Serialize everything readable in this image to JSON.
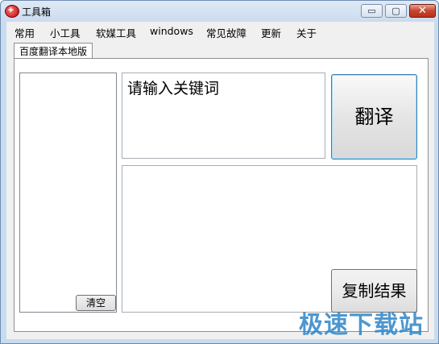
{
  "window": {
    "title": "工具箱",
    "controls": {
      "minimize": "▭",
      "maximize": "▢",
      "close": "✕"
    }
  },
  "menu": {
    "items": [
      "常用",
      "小工具",
      "软媒工具",
      "windows",
      "常见故障",
      "更新",
      "关于"
    ]
  },
  "tab": {
    "label": "百度翻译本地版"
  },
  "left_panel": {
    "clear_label": "清空"
  },
  "input": {
    "placeholder": "请输入关键词"
  },
  "buttons": {
    "translate_label": "翻译",
    "copy_label": "复制结果"
  },
  "watermark": {
    "text": "极速下载站"
  },
  "colors": {
    "accent": "#3c7fb1",
    "watermark": "#2d86c8",
    "close": "#c8452c"
  }
}
